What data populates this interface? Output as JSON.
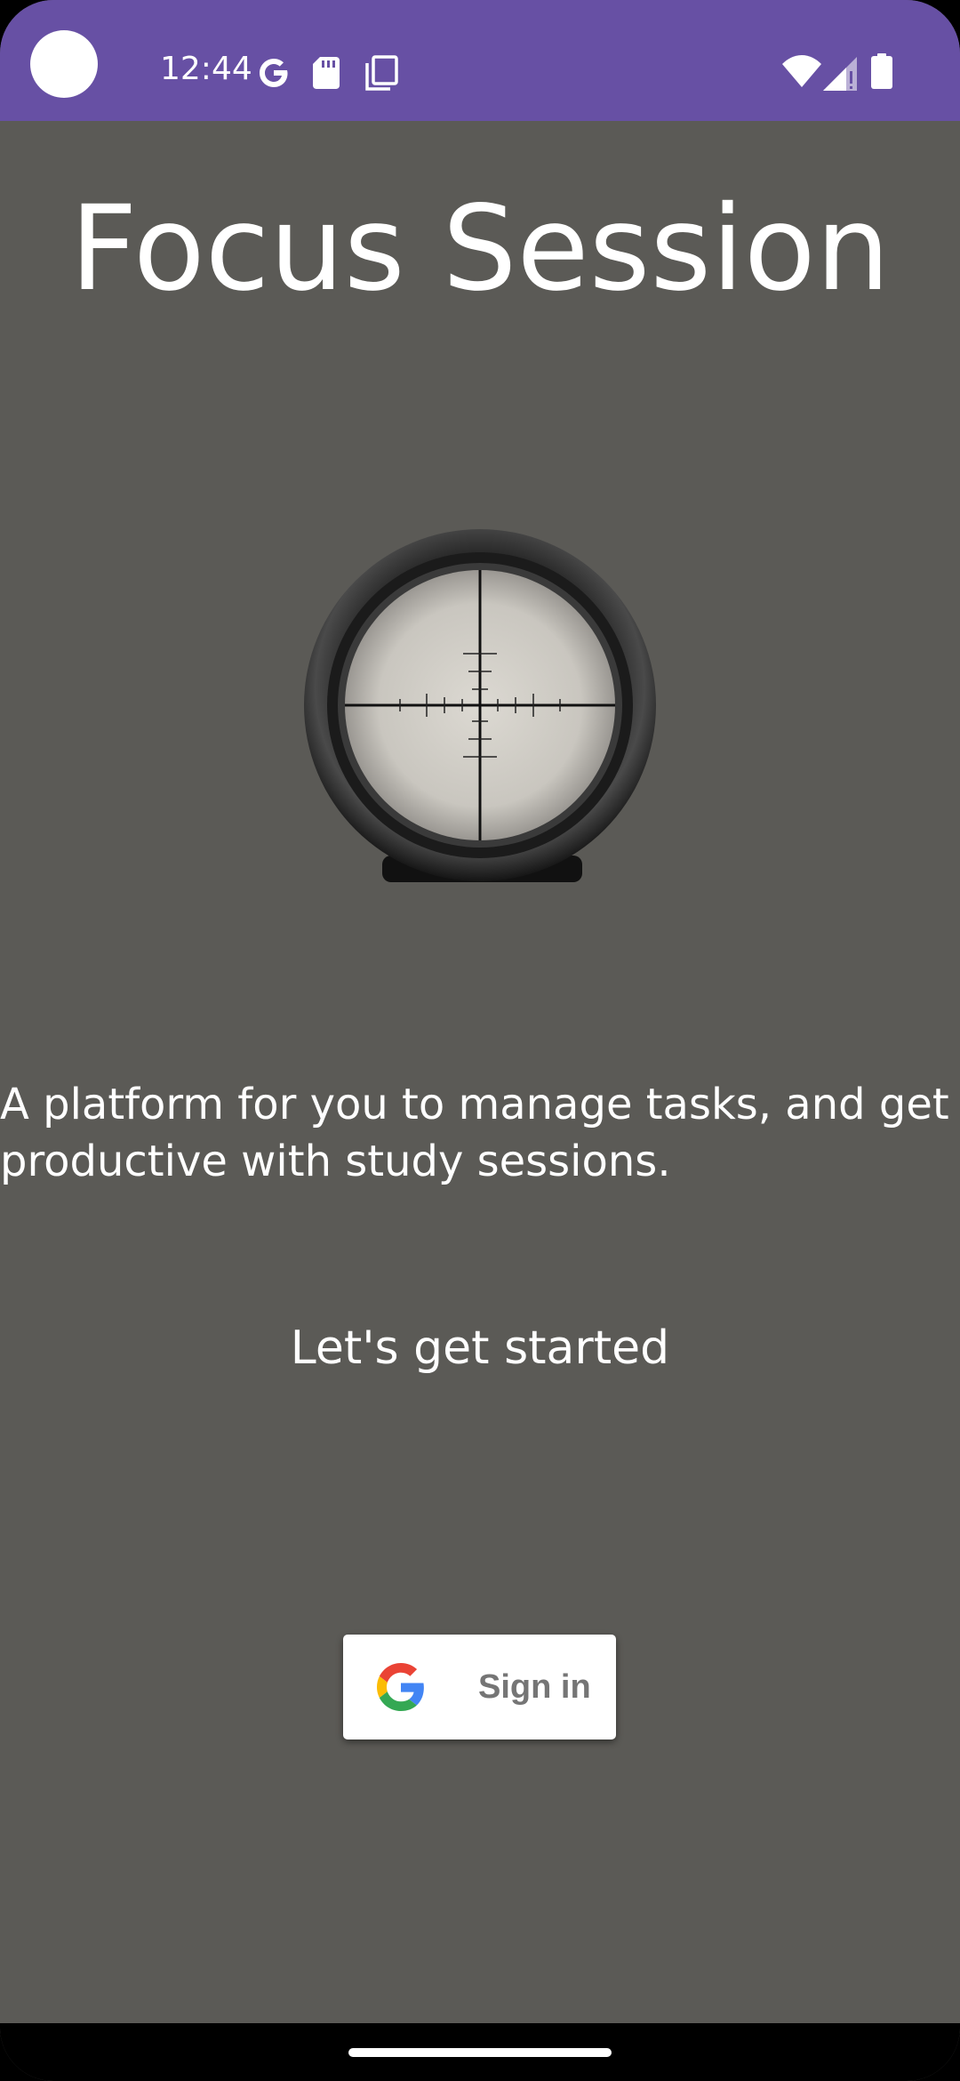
{
  "status_bar": {
    "time": "12:44",
    "icons": [
      "google-g-icon",
      "sd-card-icon",
      "screenshot-icon",
      "wifi-icon",
      "cellular-signal-icon",
      "battery-icon"
    ],
    "background_color": "#6750a4"
  },
  "main": {
    "title": "Focus Session",
    "hero_image": "rifle-scope-crosshair-image",
    "tagline": "A platform for you to manage tasks, and get\nproductive with study sessions.",
    "cta_text": "Let's get started",
    "background_color": "#5b5a56"
  },
  "signin_button": {
    "label": "Sign in",
    "icon": "google-logo-icon"
  },
  "nav_bar": {
    "indicator": "home-indicator"
  }
}
